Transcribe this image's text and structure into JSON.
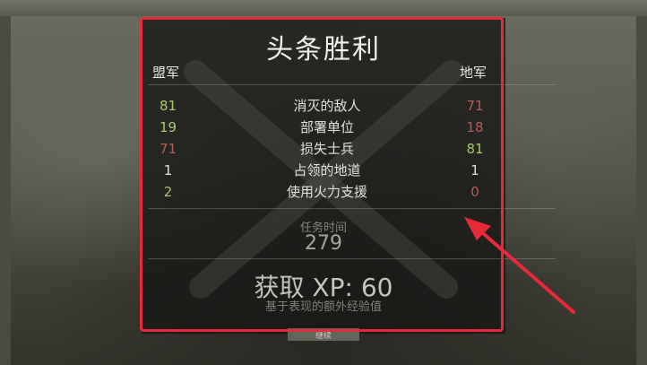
{
  "title": "头条胜利",
  "left_side": "盟军",
  "right_side": "地军",
  "colors": {
    "green": "#a9c96b",
    "red": "#b85a5a",
    "white": "#e2e2de",
    "highlight_border": "#e8293a"
  },
  "stats": [
    {
      "label": "消灭的敌人",
      "left": "81",
      "left_color": "green",
      "right": "71",
      "right_color": "red"
    },
    {
      "label": "部署单位",
      "left": "19",
      "left_color": "green",
      "right": "18",
      "right_color": "red"
    },
    {
      "label": "损失士兵",
      "left": "71",
      "left_color": "red",
      "right": "81",
      "right_color": "green"
    },
    {
      "label": "占领的地道",
      "left": "1",
      "left_color": "white",
      "right": "1",
      "right_color": "white"
    },
    {
      "label": "使用火力支援",
      "left": "2",
      "left_color": "green",
      "right": "0",
      "right_color": "red"
    }
  ],
  "duration_label": "任务时间",
  "duration_value": "279",
  "xp_text": "获取 XP: 60",
  "xp_subtitle": "基于表现的额外经验值",
  "continue_label": "继续"
}
